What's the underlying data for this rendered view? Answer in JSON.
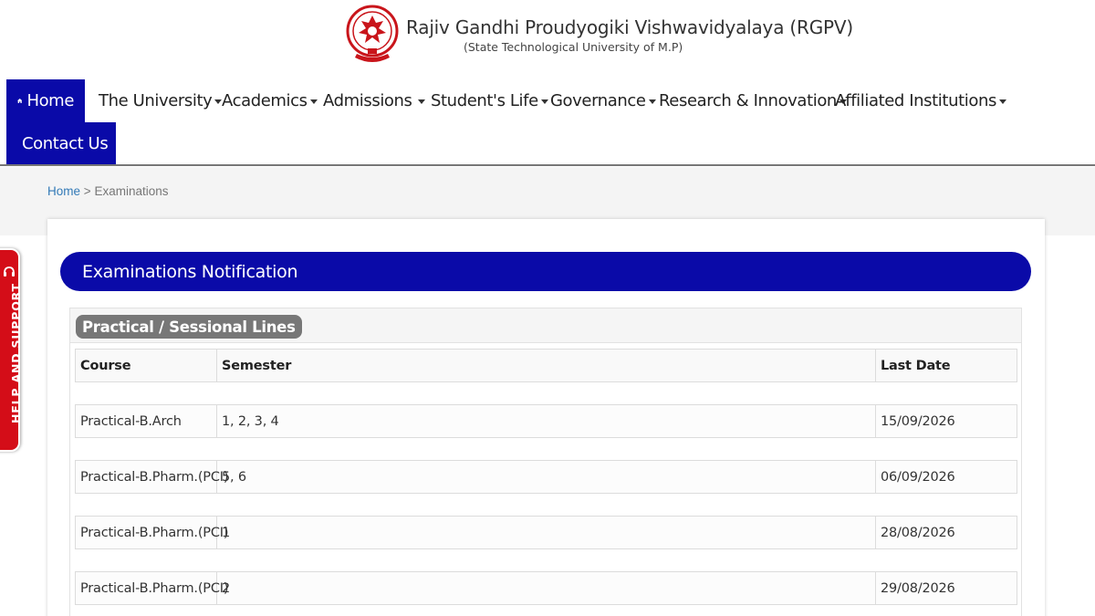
{
  "header": {
    "title": "Rajiv Gandhi Proudyogiki Vishwavidyalaya (RGPV)",
    "subtitle": "(State Technological University of M.P)",
    "logo_icon": "rgpv-emblem-icon"
  },
  "nav": {
    "items": [
      {
        "label": "Home",
        "icon": "home-icon",
        "active": true
      },
      {
        "label": "The University",
        "dropdown": true
      },
      {
        "label": "Academics",
        "dropdown": true
      },
      {
        "label": "Admissions",
        "dropdown": true
      },
      {
        "label": "Student's Life",
        "dropdown": true
      },
      {
        "label": "Governance",
        "dropdown": true
      },
      {
        "label": "Research & Innovation",
        "dropdown": true
      },
      {
        "label": "Affiliated Institutions",
        "dropdown": true
      },
      {
        "label": "Contact Us",
        "icon": "contact-card-icon",
        "active": true
      }
    ]
  },
  "breadcrumb": {
    "home": "Home",
    "separator": ">",
    "current": "Examinations"
  },
  "main": {
    "section_title": "Examinations Notification",
    "panel_title": "Practical / Sessional Lines",
    "table": {
      "headers": [
        "Course",
        "Semester",
        "Last Date"
      ],
      "rows": [
        {
          "course": "Practical-B.Arch",
          "semester": "1, 2, 3, 4",
          "last_date": "15/09/2026"
        },
        {
          "course": "Practical-B.Pharm.(PCI)",
          "semester": "5, 6",
          "last_date": "06/09/2026"
        },
        {
          "course": "Practical-B.Pharm.(PCI)",
          "semester": "1",
          "last_date": "28/08/2026"
        },
        {
          "course": "Practical-B.Pharm.(PCI)",
          "semester": "2",
          "last_date": "29/08/2026"
        }
      ]
    }
  },
  "help": {
    "label": "HELP AND SUPPORT",
    "icon": "headset-icon"
  },
  "colors": {
    "primary_blue": "#0a0aa8",
    "help_red": "#d40d18",
    "pill_gray": "#777777",
    "link_blue": "#337ab7"
  }
}
